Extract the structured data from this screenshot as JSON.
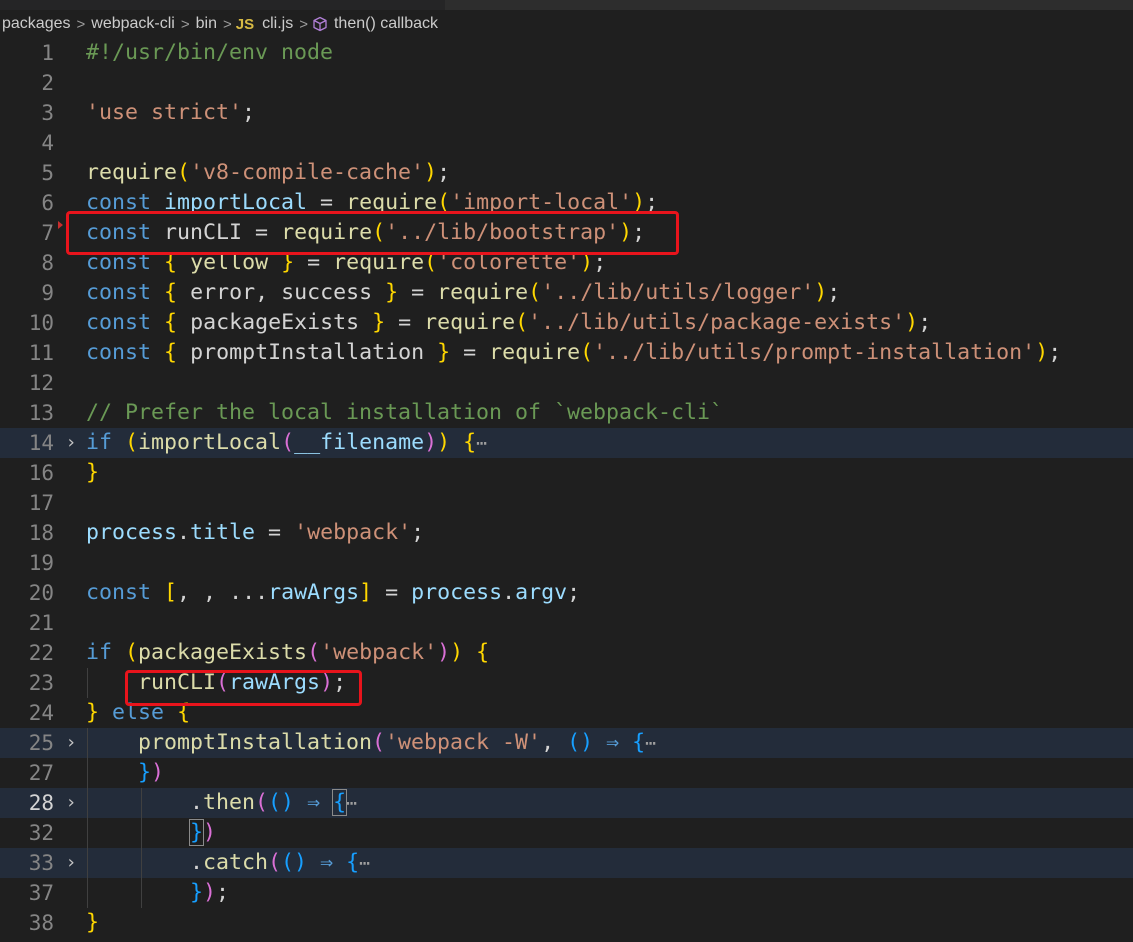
{
  "breadcrumb": {
    "items": [
      "packages",
      "webpack-cli",
      "bin"
    ],
    "file_badge": "JS",
    "file": "cli.js",
    "symbol": "then() callback",
    "separator": ">"
  },
  "editor": {
    "fold_collapsed_glyph": "›",
    "ellipsis": "⋯",
    "line_numbers": [
      "1",
      "2",
      "3",
      "4",
      "5",
      "6",
      "7",
      "8",
      "9",
      "10",
      "11",
      "12",
      "13",
      "14",
      "16",
      "17",
      "18",
      "19",
      "20",
      "21",
      "22",
      "23",
      "24",
      "25",
      "27",
      "28",
      "32",
      "33",
      "37",
      "38"
    ],
    "tokens": {
      "shebang": "#!/usr/bin/env node",
      "use_strict": "'use strict'",
      "semi": ";",
      "require": "require",
      "const": "const",
      "if": "if",
      "else": "else",
      "v8_cache": "'v8-compile-cache'",
      "importLocal": "importLocal",
      "import_local_str": "'import-local'",
      "runCLI": "runCLI",
      "bootstrap_str": "'../lib/bootstrap'",
      "yellow": "yellow",
      "colorette_str": "'colorette'",
      "error": "error",
      "success": "success",
      "logger_str": "'../lib/utils/logger'",
      "packageExists": "packageExists",
      "package_exists_str": "'../lib/utils/package-exists'",
      "promptInstallation": "promptInstallation",
      "prompt_install_str": "'../lib/utils/prompt-installation'",
      "comment": "// Prefer the local installation of `webpack-cli`",
      "filename": "__filename",
      "process": "process",
      "title": "title",
      "webpack_str": "'webpack'",
      "rawArgs": "rawArgs",
      "argv": "argv",
      "webpack_w_str": "'webpack -W'",
      "then": "then",
      "catch": "catch",
      "arrow": "⇒",
      "spread": "..."
    }
  }
}
